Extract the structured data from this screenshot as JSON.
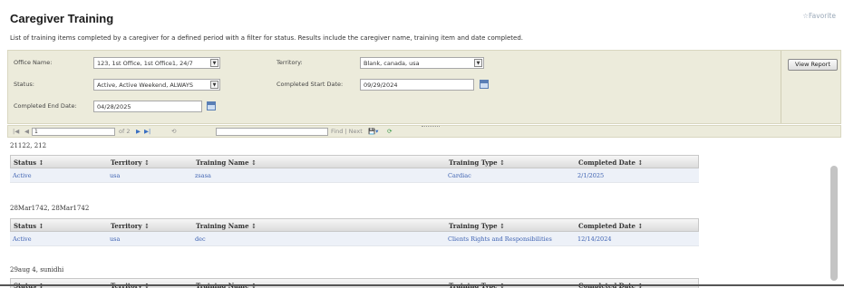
{
  "page": {
    "title": "Caregiver Training",
    "favorite": "☆Favorite",
    "description": "List of training items completed by a caregiver for a defined period with a filter for status. Results include the caregiver name, training item and date completed."
  },
  "params": {
    "office_label": "Office Name:",
    "office_value": "123, 1st Office, 1st Office1, 24/7",
    "territory_label": "Territory:",
    "territory_value": "Blank, canada, usa",
    "status_label": "Status:",
    "status_value": "Active, Active Weekend, ALWAYS",
    "start_label": "Completed Start Date:",
    "start_value": "09/29/2024",
    "end_label": "Completed End Date:",
    "end_value": "04/28/2025",
    "view_report": "View Report"
  },
  "toolbar": {
    "first": "|◀",
    "prev": "◀",
    "page_value": "1",
    "of_pages": "of 2",
    "next": "▶",
    "last": "▶|",
    "refresh": "⟲",
    "find_next": "Find | Next",
    "export": "💾▾",
    "refresh2": "⟳"
  },
  "columns": [
    "Status ↕",
    "Territory ↕",
    "Training Name ↕",
    "Training Type ↕",
    "Completed Date ↕"
  ],
  "groups": [
    {
      "name": "21122, 212",
      "rows": [
        {
          "status": "Active",
          "territory": "usa",
          "training": "zsasa",
          "type": "Cardiac",
          "date": "2/1/2025"
        }
      ]
    },
    {
      "name": "28Mar1742, 28Mar1742",
      "rows": [
        {
          "status": "Active",
          "territory": "usa",
          "training": "dec",
          "type": "Clients Rights and Responsibilities",
          "date": "12/14/2024"
        }
      ]
    },
    {
      "name": "29aug 4, sunidhi",
      "rows": []
    }
  ]
}
